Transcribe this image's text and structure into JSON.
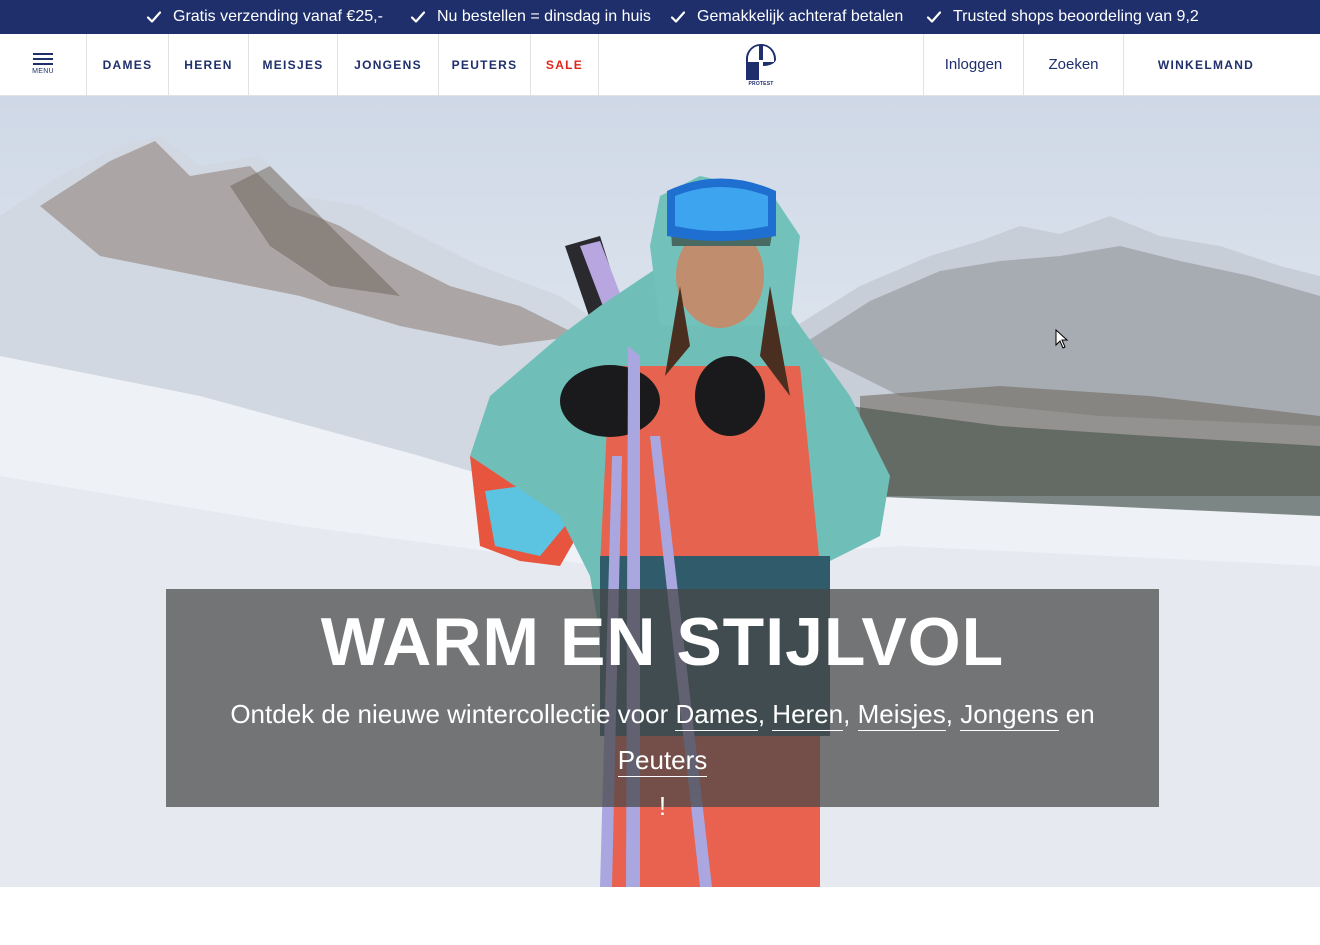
{
  "usp_bar": {
    "items": [
      "Gratis verzending vanaf €25,-",
      "Nu bestellen = dinsdag in huis",
      "Gemakkelijk achteraf betalen",
      "Trusted shops beoordeling van 9,2"
    ],
    "icon": "checkmark-icon"
  },
  "header": {
    "menu_label": "MENU",
    "nav": [
      "DAMES",
      "HEREN",
      "MEISJES",
      "JONGENS",
      "PEUTERS",
      "SALE"
    ],
    "sale_color": "#e0251b",
    "logo_text": "PROTEST",
    "login": "Inloggen",
    "search": "Zoeken",
    "cart": "WINKELMAND"
  },
  "hero": {
    "title": "WARM EN STIJLVOL",
    "subtitle_prefix": "Ontdek de nieuwe wintercollectie voor",
    "links": [
      "Dames",
      "Heren",
      "Meisjes",
      "Jongens",
      "Peuters"
    ],
    "conjunction": "en",
    "suffix": "!",
    "image": "skier-in-snowy-mountains"
  },
  "colors": {
    "brand_navy": "#1e2f6b",
    "overlay": "#464646"
  }
}
